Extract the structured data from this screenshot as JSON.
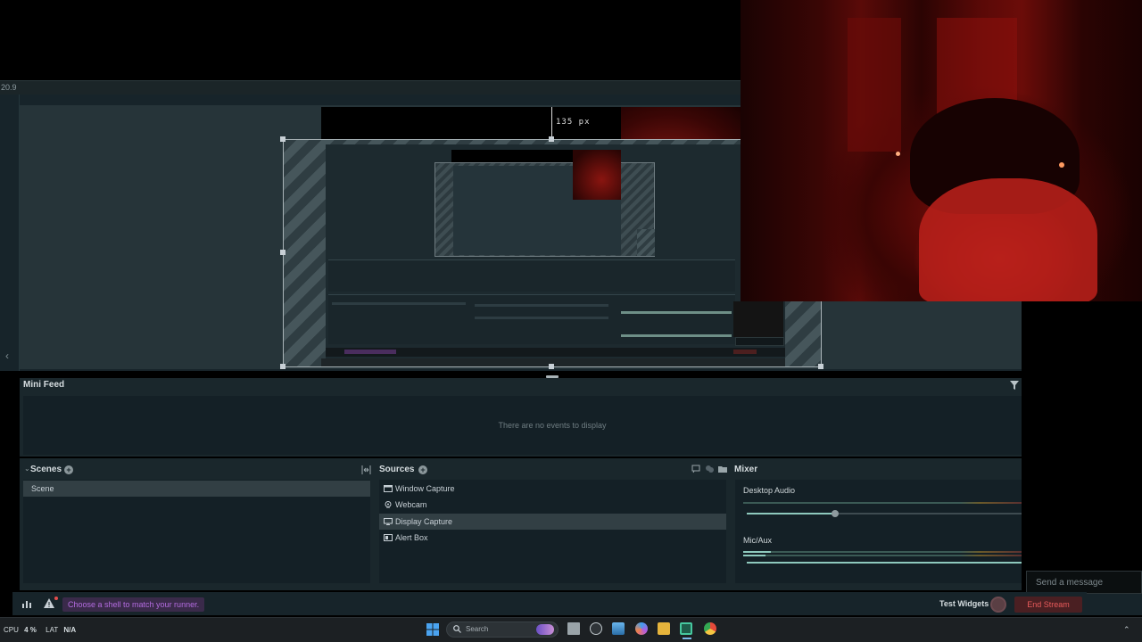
{
  "editor": {
    "zoom_label": "20.9",
    "px_label": "135 px"
  },
  "minifeed": {
    "title": "Mini Feed",
    "empty_text": "There are no events to display"
  },
  "scenes": {
    "title": "Scenes",
    "items": [
      {
        "label": "Scene",
        "selected": true
      }
    ]
  },
  "sources": {
    "title": "Sources",
    "items": [
      {
        "label": "Window Capture",
        "icon": "window-icon",
        "selected": false
      },
      {
        "label": "Webcam",
        "icon": "webcam-icon",
        "selected": false
      },
      {
        "label": "Display Capture",
        "icon": "monitor-icon",
        "selected": true
      },
      {
        "label": "Alert Box",
        "icon": "alert-box-icon",
        "selected": false
      }
    ]
  },
  "mixer": {
    "title": "Mixer",
    "channels": [
      {
        "label": "Desktop Audio",
        "level": 0.32
      },
      {
        "label": "Mic/Aux",
        "level": 1.0
      }
    ]
  },
  "statusbar": {
    "tip": "Choose a shell to match your runner.",
    "test_widgets": "Test Widgets",
    "end_stream": "End Stream"
  },
  "chat": {
    "placeholder": "Send a message"
  },
  "taskbar": {
    "cpu_label": "CPU",
    "cpu_value": "4 %",
    "lat_label": "LAT",
    "lat_value": "N/A",
    "search_placeholder": "Search"
  },
  "colors": {
    "accent": "#8ec9bd",
    "end_stream": "#e85b5b",
    "tip_text": "#b46ce0"
  }
}
